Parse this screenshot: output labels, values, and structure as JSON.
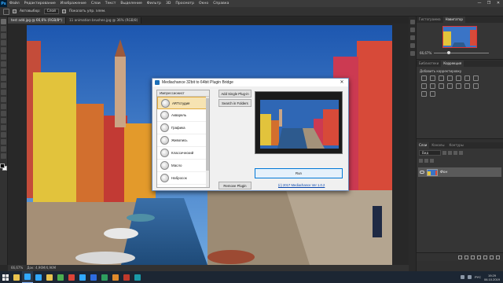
{
  "app": {
    "logo": "Ps"
  },
  "menu": [
    "Файл",
    "Редактирование",
    "Изображение",
    "Слои",
    "Текст",
    "Выделение",
    "Фильтр",
    "3D",
    "Просмотр",
    "Окно",
    "Справка"
  ],
  "window_controls": [
    "—",
    "❐",
    "✕"
  ],
  "options_bar": {
    "auto_select_label": "Автовыбор:",
    "layer_select_value": "Слой",
    "show_transform_label": "Показать упр. элем."
  },
  "doc_tabs": [
    {
      "label": "test add.jpg @ 66,6% (RGB/8*)",
      "active": true
    },
    {
      "label": "11 animation brushes.jpg @ 36% (RGB/8)",
      "active": false
    }
  ],
  "status_bar": {
    "zoom": "66,67%",
    "doc_info": "Док: 4,96M/4,96M"
  },
  "panels": {
    "navigator_tabs": [
      "Гистограмма",
      "Навигатор"
    ],
    "zoom_value": "66,67%",
    "zoom_level": 0.25,
    "adjust_tabs": [
      "Библиотеки",
      "Коррекция"
    ],
    "adjust_hint": "Добавить корректировку",
    "layers_tabs": [
      "Слои",
      "Каналы",
      "Контуры"
    ],
    "layer_filter": "Вид",
    "layer_name": "Фон"
  },
  "dialog": {
    "title": "Mediachance 32bit to 64bit Plugin Bridge",
    "close": "✕",
    "list_header": "Импрессионист",
    "plugins": [
      "ARTстудия",
      "Акварель",
      "Графика",
      "Живопись",
      "Классический",
      "Масло",
      "Набросок"
    ],
    "selected_index": 0,
    "add_button": "Add Single Plug-in",
    "search_button": "Search in Folders",
    "remove_button": "Remove Plugin",
    "run_button": "Run",
    "version_link": "(c) 2017 Mediachance Ver 1.0.2"
  },
  "taskbar": {
    "apps": [
      {
        "name": "explorer",
        "color": "#e9c34f"
      },
      {
        "name": "photoshop",
        "color": "#31a8ff"
      },
      {
        "name": "photoshop-2",
        "color": "#31a8ff"
      },
      {
        "name": "folder",
        "color": "#e9c34f"
      },
      {
        "name": "browser",
        "color": "#4caf50"
      },
      {
        "name": "chrome",
        "color": "#db4437"
      },
      {
        "name": "ps-3",
        "color": "#31a8ff"
      },
      {
        "name": "app-blue",
        "color": "#2d6cdf"
      },
      {
        "name": "app-green",
        "color": "#2e9e5e"
      },
      {
        "name": "app-orange",
        "color": "#e08a2b"
      },
      {
        "name": "app-red",
        "color": "#c0392b"
      },
      {
        "name": "app-teal",
        "color": "#1a9aa8"
      }
    ],
    "time": "19:29",
    "date": "06.10.2019",
    "lang": "РУС"
  }
}
